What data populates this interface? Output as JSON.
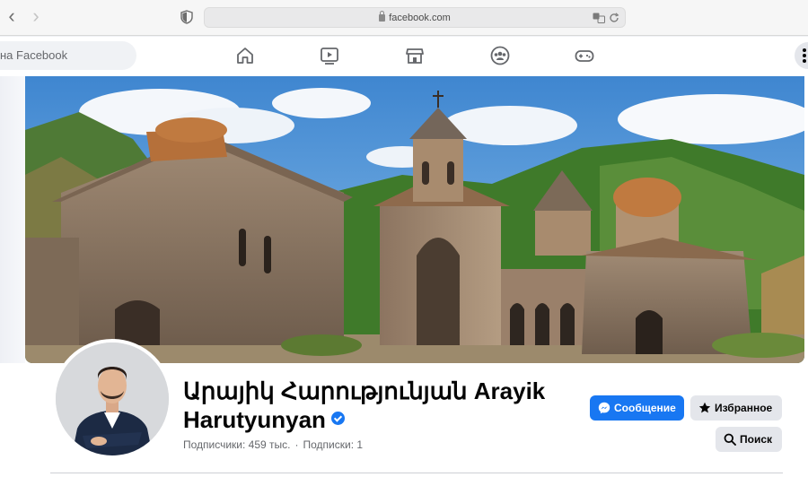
{
  "browser": {
    "url": "facebook.com",
    "back_icon": "chevron-left-icon",
    "forward_icon": "chevron-right-icon"
  },
  "fb_nav": {
    "search_placeholder": "на Facebook",
    "icons": [
      "home-icon",
      "watch-icon",
      "marketplace-icon",
      "groups-icon",
      "gaming-icon",
      "menu-dots-icon"
    ]
  },
  "profile": {
    "name": "Արայիկ Հարությունյան Arayik Harutyunyan",
    "verified": true,
    "followers": "Подписчики: 459 тыс.",
    "separator": "·",
    "following": "Подписки: 1"
  },
  "actions": {
    "message": "Сообщение",
    "favorites": "Избранное",
    "search": "Поиск"
  },
  "colors": {
    "accent": "#1877f2",
    "sky": "#4a8fd4",
    "forest": "#3f7a2a"
  }
}
